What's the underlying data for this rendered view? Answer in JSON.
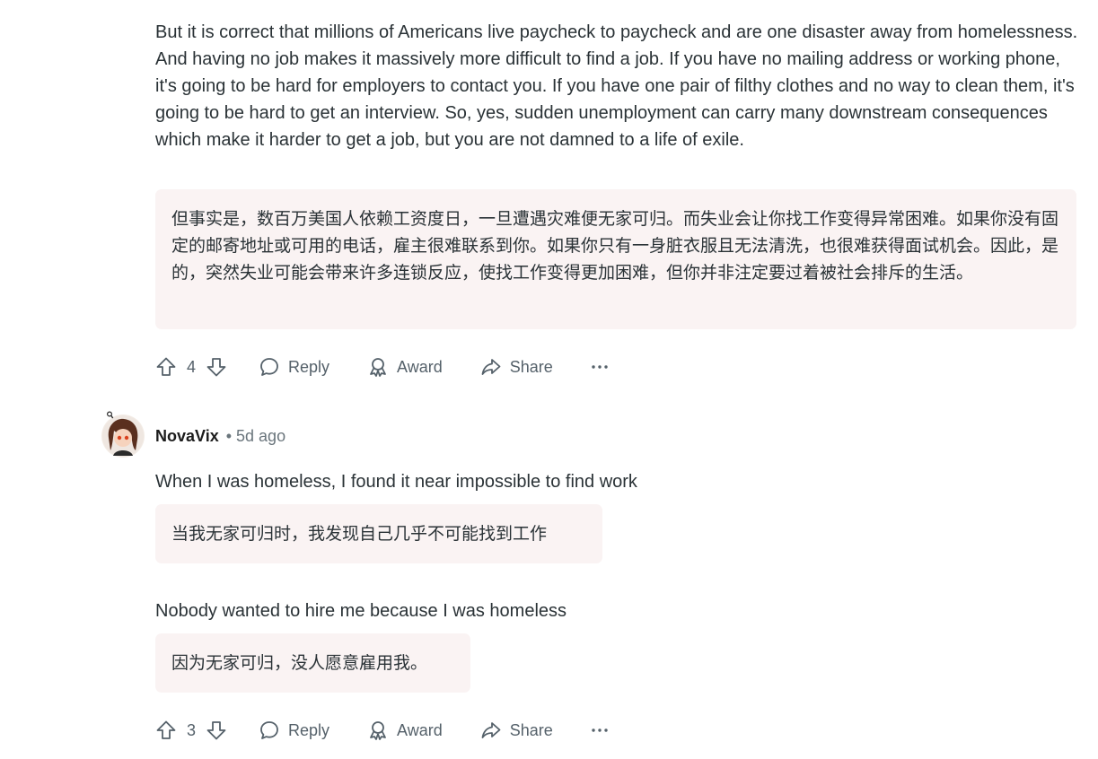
{
  "top_comment": {
    "text": "But it is correct that millions of Americans live paycheck to paycheck and are one disaster away from homelessness. And having no job makes it massively more difficult to find a job. If you have no mailing address or working phone, it's going to be hard for employers to contact you. If you have one pair of filthy clothes and no way to clean them, it's going to be hard to get an interview. So, yes, sudden unemployment can carry many downstream consequences which make it harder to get a job, but you are not damned to a life of exile.",
    "translation": "但事实是，数百万美国人依赖工资度日，一旦遭遇灾难便无家可归。而失业会让你找工作变得异常困难。如果你没有固定的邮寄地址或可用的电话，雇主很难联系到你。如果你只有一身脏衣服且无法清洗，也很难获得面试机会。因此，是的，突然失业可能会带来许多连锁反应，使找工作变得更加困难，但你并非注定要过着被社会排斥的生活。",
    "score": "4",
    "reply_label": "Reply",
    "award_label": "Award",
    "share_label": "Share"
  },
  "reply_comment": {
    "username": "NovaVix",
    "timestamp": "• 5d ago",
    "text1": "When I was homeless, I found it near impossible to find work",
    "translation1": "当我无家可归时，我发现自己几乎不可能找到工作",
    "text2": "Nobody wanted to hire me because I was homeless",
    "translation2": "因为无家可归，没人愿意雇用我。",
    "score": "3",
    "reply_label": "Reply",
    "award_label": "Award",
    "share_label": "Share"
  },
  "icons": [
    "upvote-icon",
    "downvote-icon",
    "reply-icon",
    "award-icon",
    "share-icon",
    "more-icon"
  ],
  "colors": {
    "translation_bg": "#faf3f3",
    "text": "#2a3236",
    "muted": "#55616a"
  }
}
